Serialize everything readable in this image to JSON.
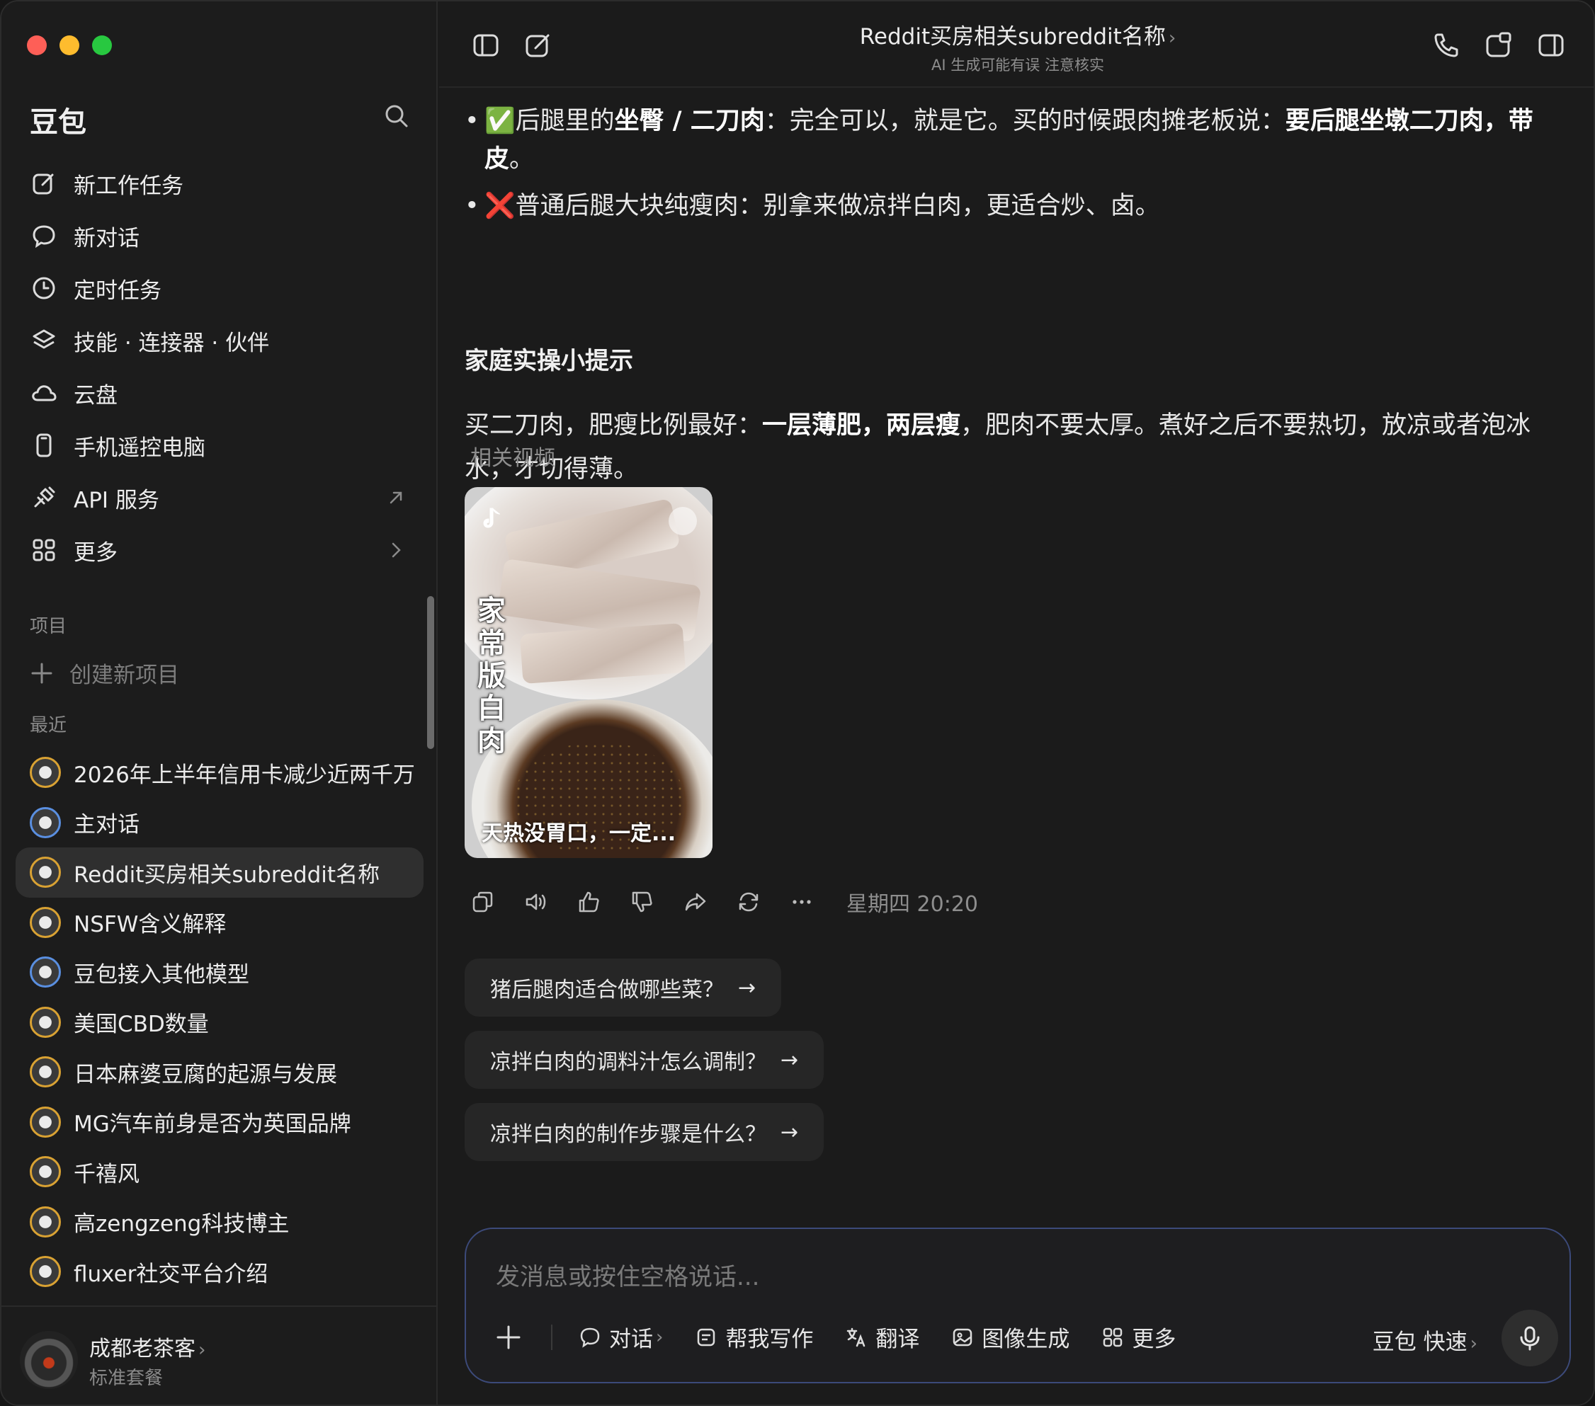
{
  "sidebar": {
    "brand": "豆包",
    "nav": [
      {
        "label": "新工作任务",
        "icon": "edit-icon"
      },
      {
        "label": "新对话",
        "icon": "chat-bubble-icon"
      },
      {
        "label": "定时任务",
        "icon": "clock-icon"
      },
      {
        "label": "技能 · 连接器 · 伙伴",
        "icon": "layers-icon"
      },
      {
        "label": "云盘",
        "icon": "cloud-icon"
      },
      {
        "label": "手机遥控电脑",
        "icon": "phone-icon"
      },
      {
        "label": "API 服务",
        "icon": "plug-icon"
      },
      {
        "label": "更多",
        "icon": "grid-icon"
      }
    ],
    "projects_label": "项目",
    "create_project": "创建新项目",
    "recent_label": "最近",
    "recent": [
      {
        "label": "2026年上半年信用卡减少近两千万",
        "active": false
      },
      {
        "label": "主对话",
        "active": false
      },
      {
        "label": "Reddit买房相关subreddit名称",
        "active": true
      },
      {
        "label": "NSFW含义解释",
        "active": false
      },
      {
        "label": "豆包接入其他模型",
        "active": false
      },
      {
        "label": "美国CBD数量",
        "active": false
      },
      {
        "label": "日本麻婆豆腐的起源与发展",
        "active": false
      },
      {
        "label": "MG汽车前身是否为英国品牌",
        "active": false
      },
      {
        "label": "千禧风",
        "active": false
      },
      {
        "label": "高zengzeng科技博主",
        "active": false
      },
      {
        "label": "fluxer社交平台介绍",
        "active": false
      }
    ],
    "user": {
      "name": "成都老茶客",
      "plan": "标准套餐"
    }
  },
  "header": {
    "title": "Reddit买房相关subreddit名称",
    "subtitle": "AI 生成可能有误 注意核实"
  },
  "message": {
    "bullet1_emoji": "✅",
    "bullet1_a": "后腿里的",
    "bullet1_b": "坐臀 / 二刀肉",
    "bullet1_c": "：完全可以，就是它。买的时候跟肉摊老板说：",
    "bullet1_d": "要后腿坐墩二刀肉，带皮",
    "bullet1_e": "。",
    "bullet2_emoji": "❌",
    "bullet2": "普通后腿大块纯瘦肉：别拿来做凉拌白肉，更适合炒、卤。",
    "heading": "家庭实操小提示",
    "para_a": "买二刀肉，肥瘦比例最好：",
    "para_b": "一层薄肥，两层瘦",
    "para_c": "，肥肉不要太厚。煮好之后不要热切，放凉或者泡冰水，才切得薄。",
    "related_label": "相关视频",
    "video_title": "家常版白肉",
    "video_caption": "天热没胃口，一定...",
    "timestamp": "星期四 20:20"
  },
  "suggestions": [
    "猪后腿肉适合做哪些菜？",
    "凉拌白肉的调料汁怎么调制？",
    "凉拌白肉的制作步骤是什么？"
  ],
  "composer": {
    "placeholder": "发消息或按住空格说话...",
    "tools": [
      "对话",
      "帮我写作",
      "翻译",
      "图像生成",
      "更多"
    ],
    "mode": "豆包 快速"
  },
  "colors": {
    "traffic_red": "#fe5f57",
    "traffic_yellow": "#febc2e",
    "traffic_green": "#28c840",
    "accent_border": "#3c4a7a"
  }
}
